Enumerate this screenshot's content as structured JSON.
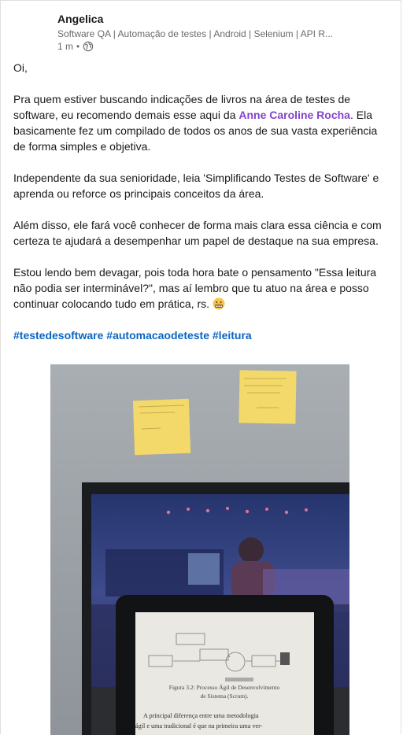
{
  "author": {
    "name": "Angelica",
    "headline": "Software QA | Automação de testes | Android | Selenium | API R...",
    "time": "1 m",
    "separator": "•",
    "visibility_icon": "globe-icon"
  },
  "post": {
    "greeting": "Oi,",
    "p1_before": "Pra quem estiver buscando indicações de livros na área de testes de software, eu recomendo demais esse aqui da ",
    "p1_mention": "Anne Caroline Rocha",
    "p1_after": ". Ela basicamente fez um compilado de todos os anos de sua vasta experiência de forma simples e objetiva.",
    "p2": "Independente da sua senioridade, leia 'Simplificando Testes de Software' e aprenda ou reforce os principais conceitos da área.",
    "p3": "Além disso, ele fará você conhecer de forma mais clara essa ciência e com certeza te ajudará a desempenhar um papel de destaque na sua empresa.",
    "p4": "Estou lendo bem devagar, pois toda hora bate o pensamento \"Essa leitura não podia ser interminável?\", mas aí lembro que tu atuo na área e posso continuar colocando tudo em prática, rs.",
    "p4_emoji": "grimacing-face-emoji",
    "hashtags": [
      "#testedesoftware",
      "#automacaodeteste",
      "#leitura"
    ]
  },
  "image": {
    "caption_title": "Figura 3.2: Processo Ágil de Desenvolvimento",
    "caption_sub": "de Sistema (Scrum).",
    "body_line1": "A principal diferença entre uma metodologia",
    "body_line2": "ágil e uma tradicional é que na primeira uma ver-"
  },
  "colors": {
    "mention": "#8344cc",
    "hashtag": "#0a66c2",
    "wall": "#a3a8ad",
    "sticky_note": "#f3d86a"
  }
}
